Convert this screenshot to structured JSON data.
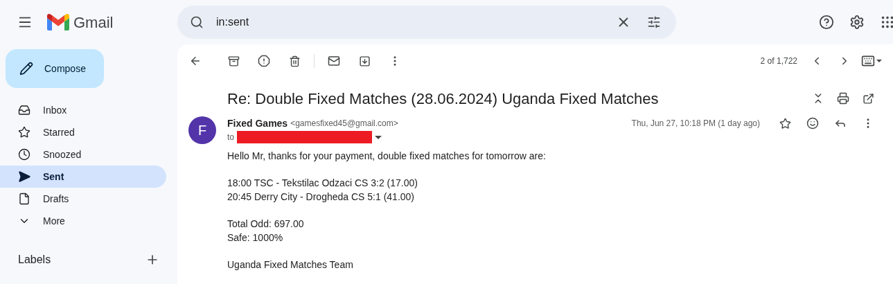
{
  "app_name": "Gmail",
  "search": {
    "value": "in:sent"
  },
  "compose": "Compose",
  "nav": [
    {
      "kind": "inbox",
      "label": "Inbox",
      "selected": false
    },
    {
      "kind": "starred",
      "label": "Starred",
      "selected": false
    },
    {
      "kind": "snoozed",
      "label": "Snoozed",
      "selected": false
    },
    {
      "kind": "sent",
      "label": "Sent",
      "selected": true
    },
    {
      "kind": "drafts",
      "label": "Drafts",
      "selected": false
    },
    {
      "kind": "more",
      "label": "More",
      "selected": false
    }
  ],
  "labels_heading": "Labels",
  "pagination": "2 of 1,722",
  "message": {
    "subject": "Re: Double Fixed Matches (28.06.2024) Uganda Fixed Matches",
    "avatar_letter": "F",
    "sender_name": "Fixed Games",
    "sender_email": "<gamesfixed45@gmail.com>",
    "to_label": "to",
    "date": "Thu, Jun 27, 10:18 PM (1 day ago)",
    "body": [
      [
        "Hello Mr, thanks for your payment, double fixed matches for tomorrow are:"
      ],
      [
        "18:00 TSC - Tekstilac Odzaci CS 3:2 (17.00)",
        "20:45 Derry City - Drogheda CS 5:1 (41.00)"
      ],
      [
        "Total Odd: 697.00",
        "Safe: 1000%"
      ],
      [
        "Uganda Fixed Matches Team"
      ]
    ]
  }
}
